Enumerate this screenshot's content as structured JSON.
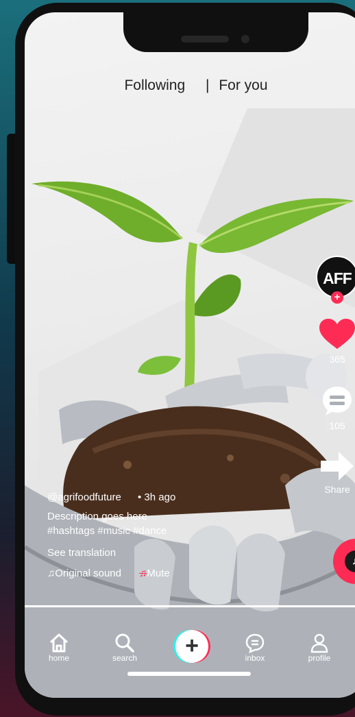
{
  "top_tabs": {
    "following": "Following",
    "separator": "|",
    "for_you": "For you"
  },
  "creator": {
    "avatar_text": "AFF",
    "follow_plus": "+"
  },
  "actions": {
    "likes": "365",
    "comments": "105",
    "share": "Share"
  },
  "post": {
    "username": "@agrifoodfuture",
    "dot": "•",
    "time": "3h ago",
    "description": "Description goes here",
    "hashtags": "#hashtags #music #dance",
    "see_translation": "See translation",
    "sound_icon": "♫",
    "sound_label": "Original sound",
    "mute_label": "Mute"
  },
  "nav": {
    "home": "home",
    "search": "search",
    "create": "+",
    "inbox": "inbox",
    "profile": "profile"
  },
  "colors": {
    "accent": "#fe2c55",
    "cyan": "#25f4ee"
  },
  "icons": [
    "home-icon",
    "search-icon",
    "create-icon",
    "inbox-icon",
    "profile-icon",
    "heart-icon",
    "comment-icon",
    "share-icon",
    "music-note-icon"
  ]
}
